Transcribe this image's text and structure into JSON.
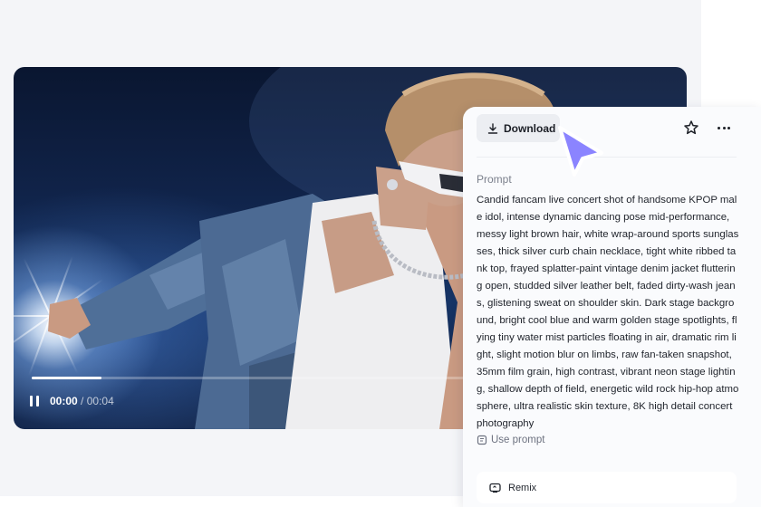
{
  "player": {
    "current_time": "00:00",
    "separator": "/",
    "total_time": "00:04",
    "progress_fraction": 0.11,
    "state": "playing"
  },
  "panel": {
    "download_label": "Download",
    "prompt_heading": "Prompt",
    "prompt_text": "Candid fancam live concert shot of handsome KPOP male idol, intense dynamic dancing pose mid-performance, messy light brown hair, white wrap-around sports sunglasses, thick silver curb chain necklace, tight white ribbed tank top, frayed splatter-paint vintage denim jacket fluttering open, studded silver leather belt, faded dirty-wash jeans, glistening sweat on shoulder skin. Dark stage background, bright cool blue and warm golden stage spotlights, flying tiny water mist particles floating in air, dramatic rim light, slight motion blur on limbs, raw fan-taken snapshot, 35mm film grain, high contrast, vibrant neon stage lighting, shallow depth of field, energetic wild rock hip-hop atmosphere, ultra realistic skin texture, 8K high detail concert photography",
    "use_prompt_label": "Use prompt",
    "remix_label": "Remix"
  },
  "icons": {
    "download": "download-icon",
    "star": "star-icon",
    "more": "more-horizontal-icon",
    "use_prompt": "document-icon",
    "remix": "remix-icon",
    "pause": "pause-icon",
    "cursor": "pointer-cursor"
  },
  "colors": {
    "cursor_fill": "#8b84ff",
    "panel_bg": "#fafbfd",
    "button_bg": "#eceef2"
  }
}
